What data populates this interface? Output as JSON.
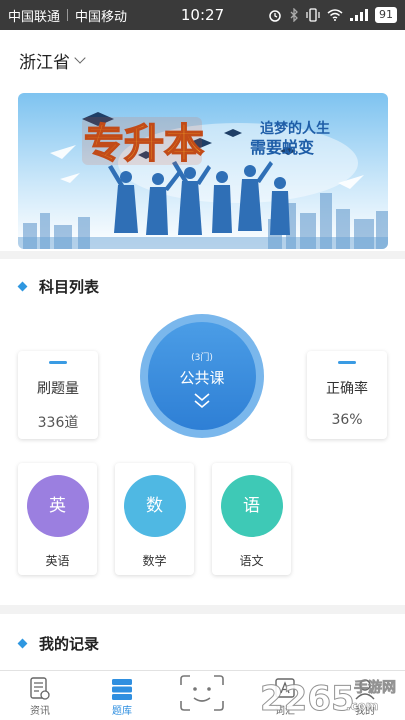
{
  "status": {
    "carrier1": "中国联通",
    "carrier2": "中国移动",
    "time": "10:27",
    "battery": "91"
  },
  "header": {
    "province": "浙江省"
  },
  "banner": {
    "title": "专升本",
    "slogan_line1": "追梦的人生",
    "slogan_line2": "需要蜕变"
  },
  "subjects_section": {
    "title": "科目列表",
    "stats": {
      "questions_label": "刷题量",
      "questions_value": "336道",
      "accuracy_label": "正确率",
      "accuracy_value": "36%"
    },
    "category": {
      "count": "(3门)",
      "name": "公共课"
    },
    "items": [
      {
        "icon_char": "英",
        "name": "英语",
        "color": "#9b7fe0"
      },
      {
        "icon_char": "数",
        "name": "数学",
        "color": "#4fb8e3"
      },
      {
        "icon_char": "语",
        "name": "语文",
        "color": "#3ec9b6"
      }
    ]
  },
  "records_section": {
    "title": "我的记录"
  },
  "tabbar": {
    "items": [
      {
        "label": "资讯",
        "icon": "news-icon"
      },
      {
        "label": "题库",
        "icon": "question-bank-icon",
        "active": true
      },
      {
        "label": "",
        "icon": "face-scan-icon"
      },
      {
        "label": "词汇",
        "icon": "vocabulary-icon"
      },
      {
        "label": "我的",
        "icon": "profile-icon"
      }
    ]
  },
  "watermark": {
    "brand": "2265",
    "domain": ".com",
    "site": "手游网"
  },
  "colors": {
    "accent": "#2f8fe0",
    "status_bar": "#3a3a3a"
  }
}
